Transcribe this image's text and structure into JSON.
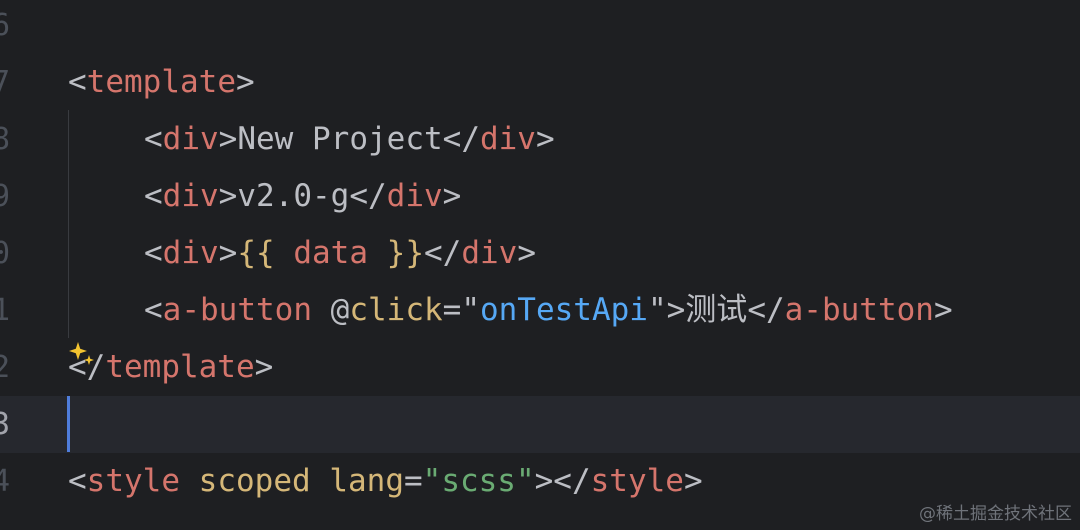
{
  "editor": {
    "lines": [
      {
        "number": "6",
        "tokens": []
      },
      {
        "number": "7",
        "tokens": [
          {
            "t": "bracket",
            "v": "<"
          },
          {
            "t": "tag",
            "v": "template"
          },
          {
            "t": "bracket",
            "v": ">"
          }
        ]
      },
      {
        "number": "8",
        "indent": true,
        "tokens": [
          {
            "t": "bracket",
            "v": "<"
          },
          {
            "t": "tag",
            "v": "div"
          },
          {
            "t": "bracket",
            "v": ">"
          },
          {
            "t": "text",
            "v": "New Project"
          },
          {
            "t": "bracket",
            "v": "</"
          },
          {
            "t": "tag",
            "v": "div"
          },
          {
            "t": "bracket",
            "v": ">"
          }
        ]
      },
      {
        "number": "9",
        "indent": true,
        "tokens": [
          {
            "t": "bracket",
            "v": "<"
          },
          {
            "t": "tag",
            "v": "div"
          },
          {
            "t": "bracket",
            "v": ">"
          },
          {
            "t": "text",
            "v": "v2.0-g"
          },
          {
            "t": "bracket",
            "v": "</"
          },
          {
            "t": "tag",
            "v": "div"
          },
          {
            "t": "bracket",
            "v": ">"
          }
        ]
      },
      {
        "number": "0",
        "indent": true,
        "tokens": [
          {
            "t": "bracket",
            "v": "<"
          },
          {
            "t": "tag",
            "v": "div"
          },
          {
            "t": "bracket",
            "v": ">"
          },
          {
            "t": "mustache",
            "v": "{{"
          },
          {
            "t": "expr",
            "v": " data "
          },
          {
            "t": "mustache",
            "v": "}}"
          },
          {
            "t": "bracket",
            "v": "</"
          },
          {
            "t": "tag",
            "v": "div"
          },
          {
            "t": "bracket",
            "v": ">"
          }
        ]
      },
      {
        "number": "1",
        "indent": true,
        "tokens": [
          {
            "t": "bracket",
            "v": "<"
          },
          {
            "t": "tag",
            "v": "a-button"
          },
          {
            "t": "text",
            "v": " "
          },
          {
            "t": "attr",
            "v": "@"
          },
          {
            "t": "attr-key",
            "v": "click"
          },
          {
            "t": "attr",
            "v": "=\""
          },
          {
            "t": "string-js",
            "v": "onTestApi"
          },
          {
            "t": "attr",
            "v": "\""
          },
          {
            "t": "bracket",
            "v": ">"
          },
          {
            "t": "text",
            "v": "测试"
          },
          {
            "t": "bracket",
            "v": "</"
          },
          {
            "t": "tag",
            "v": "a-button"
          },
          {
            "t": "bracket",
            "v": ">"
          }
        ]
      },
      {
        "number": "2",
        "tokens": [
          {
            "t": "bracket",
            "v": "</"
          },
          {
            "t": "tag",
            "v": "template"
          },
          {
            "t": "bracket",
            "v": ">"
          }
        ]
      },
      {
        "number": "3",
        "current": true,
        "tokens": []
      },
      {
        "number": "4",
        "tokens": [
          {
            "t": "bracket",
            "v": "<"
          },
          {
            "t": "tag",
            "v": "style"
          },
          {
            "t": "text",
            "v": " "
          },
          {
            "t": "attr-key",
            "v": "scoped"
          },
          {
            "t": "text",
            "v": " "
          },
          {
            "t": "attr-key",
            "v": "lang"
          },
          {
            "t": "attr",
            "v": "="
          },
          {
            "t": "string",
            "v": "\"scss\""
          },
          {
            "t": "bracket",
            "v": "></"
          },
          {
            "t": "tag",
            "v": "style"
          },
          {
            "t": "bracket",
            "v": ">"
          }
        ]
      }
    ]
  },
  "icons": {
    "sparkle": "sparkle-icon"
  },
  "colors": {
    "background": "#1e1f22",
    "tag": "#d5756c",
    "attribute": "#d5b778",
    "string": "#6aab73",
    "js_string": "#56a8f5",
    "caret": "#4f7ddb"
  },
  "watermark": "@稀土掘金技术社区"
}
